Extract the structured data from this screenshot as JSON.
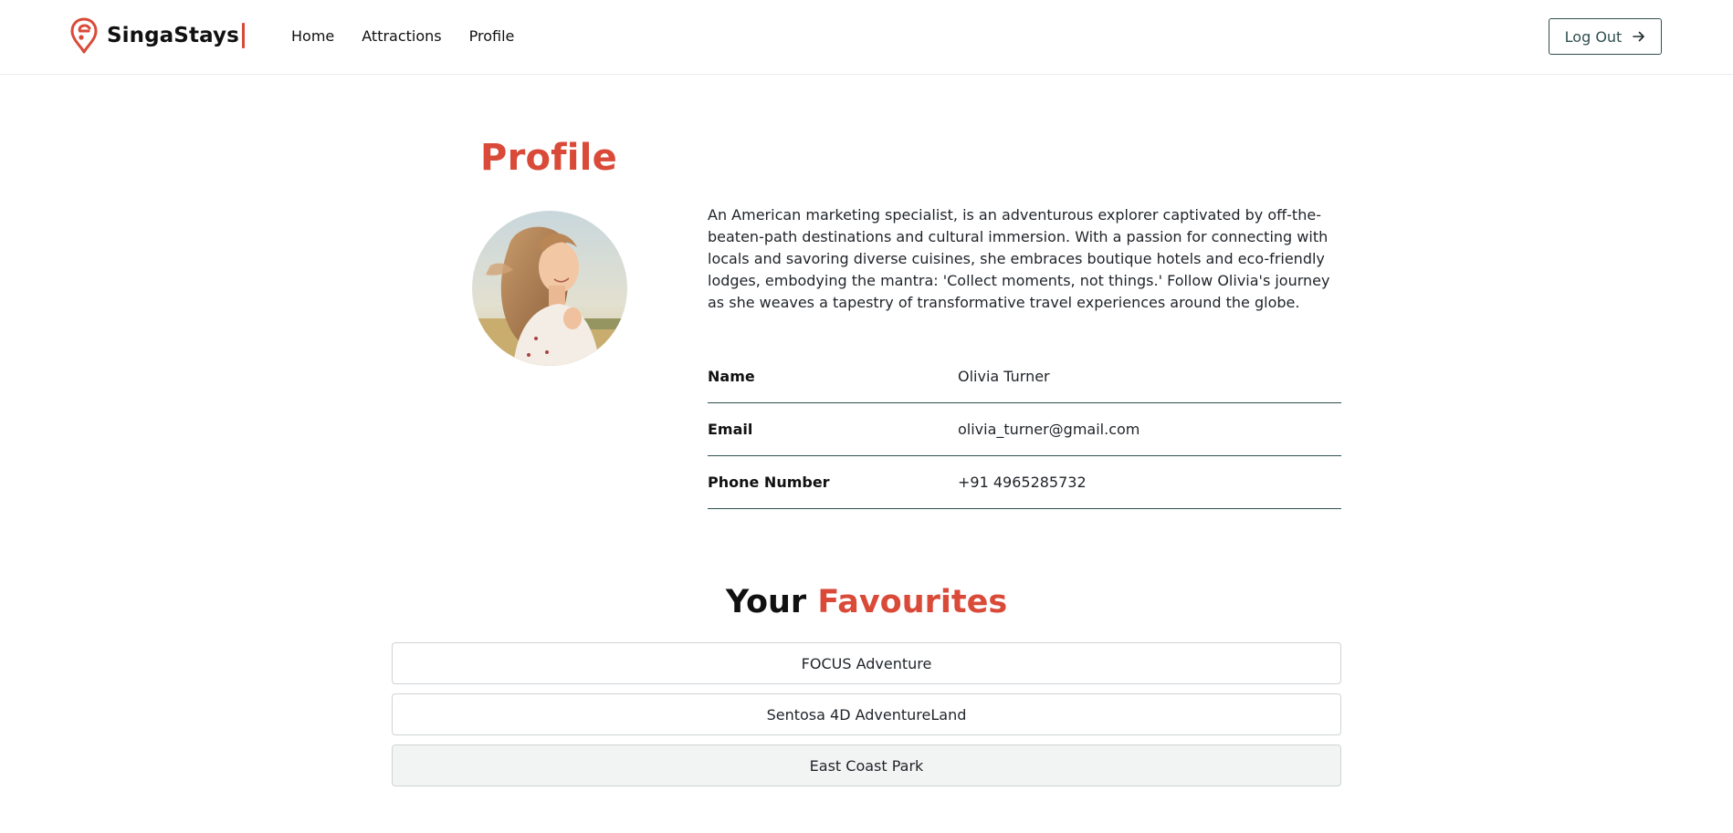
{
  "header": {
    "brand_name": "SingaStays",
    "nav": [
      {
        "label": "Home"
      },
      {
        "label": "Attractions"
      },
      {
        "label": "Profile"
      }
    ],
    "logout_label": "Log Out"
  },
  "profile": {
    "title": "Profile",
    "bio": "An American marketing specialist, is an adventurous explorer captivated by off-the-beaten-path destinations and cultural immersion. With a passion for connecting with locals and savoring diverse cuisines, she embraces boutique hotels and eco-friendly lodges, embodying the mantra: 'Collect moments, not things.' Follow Olivia's journey as she weaves a tapestry of transformative travel experiences around the globe.",
    "fields": [
      {
        "label": "Name",
        "value": "Olivia Turner"
      },
      {
        "label": "Email",
        "value": "olivia_turner@gmail.com"
      },
      {
        "label": "Phone Number",
        "value": "+91 4965285732"
      }
    ]
  },
  "favourites": {
    "title_prefix": "Your",
    "title_accent": "Favourites",
    "items": [
      {
        "label": "FOCUS Adventure"
      },
      {
        "label": "Sentosa 4D AdventureLand"
      },
      {
        "label": "East Coast Park"
      }
    ]
  },
  "colors": {
    "accent": "#d94a38",
    "border_dark": "#2f4f4f",
    "hover_bg": "#f2f3f3"
  },
  "icons": {
    "brand": "location-pin-logo-icon",
    "logout": "arrow-right-icon"
  }
}
